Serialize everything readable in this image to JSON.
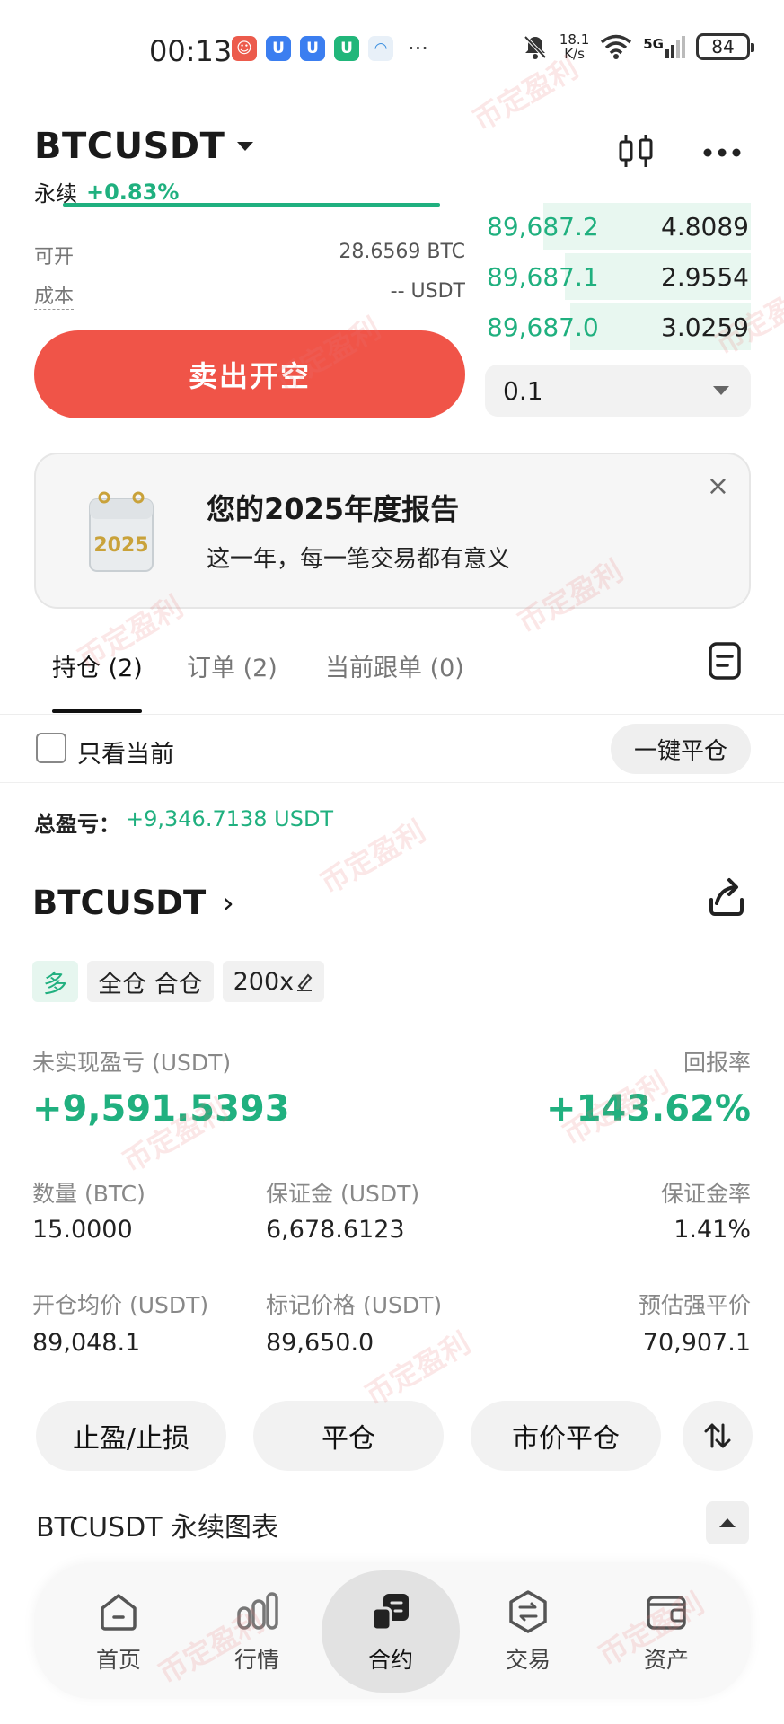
{
  "status_bar": {
    "time": "00:13",
    "net_speed_value": "18.1",
    "net_speed_unit": "K/s",
    "network": "5G",
    "battery": "84"
  },
  "header": {
    "pair": "BTCUSDT",
    "contract_type": "永续",
    "change": "+0.83%"
  },
  "trade_info": {
    "available_label": "可开",
    "available_value": "28.6569 BTC",
    "cost_label": "成本",
    "cost_value": "-- USDT"
  },
  "orderbook": [
    {
      "price": "89,687.2",
      "qty": "4.8089",
      "depth": 0.78
    },
    {
      "price": "89,687.1",
      "qty": "2.9554",
      "depth": 0.7
    },
    {
      "price": "89,687.0",
      "qty": "3.0259",
      "depth": 0.68
    }
  ],
  "sell_button_label": "卖出开空",
  "qty_select_value": "0.1",
  "banner": {
    "badge": "2025",
    "title": "您的2025年度报告",
    "subtitle": "这一年，每一笔交易都有意义",
    "close": "×"
  },
  "tabs": [
    {
      "label": "持仓 (2)",
      "active": true
    },
    {
      "label": "订单 (2)",
      "active": false
    },
    {
      "label": "当前跟单 (0)",
      "active": false
    }
  ],
  "filter": {
    "only_current_label": "只看当前",
    "close_all_label": "一键平仓"
  },
  "total_pnl": {
    "label": "总盈亏：",
    "value": "+9,346.7138 USDT"
  },
  "position": {
    "symbol": "BTCUSDT",
    "chevron": "›",
    "side_tag": "多",
    "margin_tag": "全仓 合仓",
    "leverage_tag": "200x",
    "unrealized_label": "未实现盈亏 (USDT)",
    "unrealized_value": "+9,591.5393",
    "roe_label": "回报率",
    "roe_value": "+143.62%",
    "qty_label": "数量 (BTC)",
    "qty_value": "15.0000",
    "margin_label": "保证金 (USDT)",
    "margin_value": "6,678.6123",
    "margin_ratio_label": "保证金率",
    "margin_ratio_value": "1.41%",
    "entry_label": "开仓均价 (USDT)",
    "entry_value": "89,048.1",
    "mark_label": "标记价格 (USDT)",
    "mark_value": "89,650.0",
    "liq_label": "预估强平价",
    "liq_value": "70,907.1"
  },
  "actions": {
    "tpsl": "止盈/止损",
    "close": "平仓",
    "market_close": "市价平仓"
  },
  "chart_section_label": "BTCUSDT 永续图表",
  "nav": [
    {
      "label": "首页",
      "icon": "home-icon"
    },
    {
      "label": "行情",
      "icon": "market-icon"
    },
    {
      "label": "合约",
      "icon": "futures-icon",
      "active": true
    },
    {
      "label": "交易",
      "icon": "trade-icon"
    },
    {
      "label": "资产",
      "icon": "wallet-icon"
    }
  ],
  "watermark_text": "币定盈利",
  "colors": {
    "green": "#20b07f",
    "red": "#f05448"
  }
}
